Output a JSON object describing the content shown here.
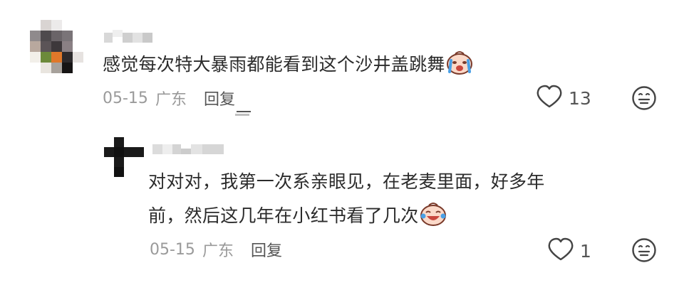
{
  "comments": [
    {
      "text": "感觉每次特大暴雨都能看到这个沙井盖跳舞",
      "date": "05-15",
      "location": "广东",
      "reply_label": "回复",
      "like_count": "13",
      "emoji_icon": "crying-face-icon",
      "avatar_colors": [
        "#ffffff",
        "#d9d4d2",
        "#eceaea",
        "#ffffff",
        "#ffffff",
        "#8f8a8c",
        "#4e4a4d",
        "#6a6468",
        "#7a7478",
        "#ffffff",
        "#b8a89e",
        "#5b5457",
        "#3d383b",
        "#8a8084",
        "#ffffff",
        "#f2efe9",
        "#6c8a3a",
        "#e0782a",
        "#2d2a2c",
        "#e6e2e0",
        "#ffffff",
        "#e9e5df",
        "#a7a19b",
        "#161414",
        "#ffffff"
      ]
    }
  ],
  "reply": {
    "line1": "对对对，我第一次系亲眼见，在老麦里面，好多年",
    "line2": "前，然后这几年在小红书看了几次",
    "date": "05-15",
    "location": "广东",
    "reply_label": "回复",
    "like_count": "1",
    "emoji_icon": "laughing-tears-face-icon",
    "avatar_colors": [
      "#ffffff",
      "#1a1a1a",
      "#ffffff",
      "#ffffff",
      "#1a1a1a",
      "#111111",
      "#1a1a1a",
      "#1a1a1a",
      "#ffffff",
      "#1a1a1a",
      "#ffffff",
      "#ffffff",
      "#ffffff",
      "#111111",
      "#ffffff",
      "#ffffff"
    ]
  },
  "colors": {
    "text": "#2b2b2b",
    "meta": "#9a9a9a",
    "icon": "#444444"
  }
}
